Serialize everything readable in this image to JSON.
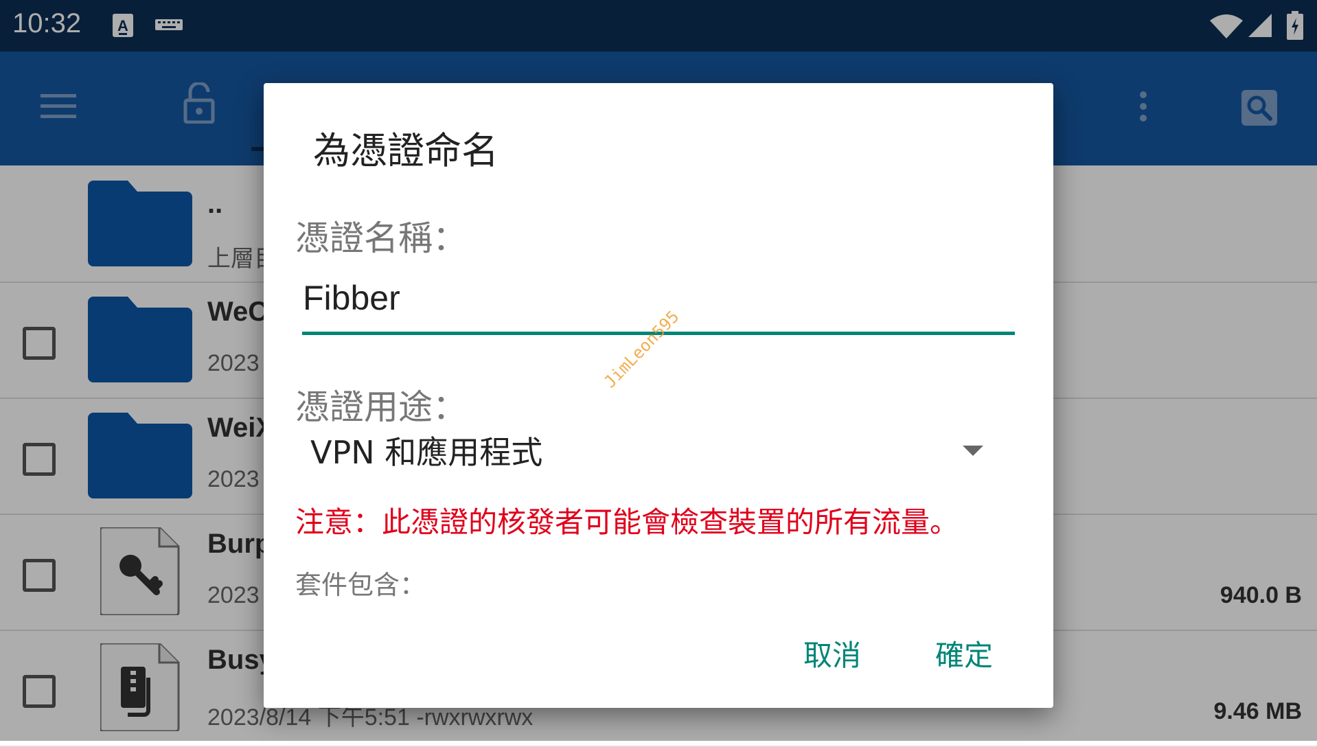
{
  "status_bar": {
    "time": "10:32",
    "icons": [
      "text-input-icon",
      "keyboard-icon",
      "wifi-icon",
      "cell-signal-icon",
      "battery-charging-icon"
    ]
  },
  "toolbar": {
    "icons": [
      "menu-icon",
      "unlock-icon",
      "more-vert-icon",
      "search-icon"
    ]
  },
  "file_list": {
    "rows": [
      {
        "name": "..",
        "meta": "上層目",
        "icon": "folder-icon"
      },
      {
        "name": "WeC",
        "meta": "2023",
        "icon": "folder-icon"
      },
      {
        "name": "WeiX",
        "meta": "2023",
        "icon": "folder-icon"
      },
      {
        "name": "Burp",
        "meta": "2023",
        "size": "940.0 B",
        "icon": "certificate-key-icon"
      },
      {
        "name": "Busy",
        "meta": "2023/8/14 下午5:51    -rwxrwxrwx",
        "size": "9.46 MB",
        "icon": "zip-archive-icon"
      }
    ]
  },
  "dialog": {
    "title": "為憑證命名",
    "name_label": "憑證名稱：",
    "name_value": "Fibber",
    "usage_label": "憑證用途：",
    "usage_value": "VPN 和應用程式",
    "warning": "注意：此憑證的核發者可能會檢查裝置的所有流量。",
    "package_label": "套件包含：",
    "cancel": "取消",
    "ok": "確定",
    "watermark": "JimLeon595"
  },
  "colors": {
    "status_bar": "#0c2f56",
    "toolbar": "#1557a1",
    "accent": "#008577",
    "warning": "#e0001b",
    "folder": "#0d57a8"
  }
}
